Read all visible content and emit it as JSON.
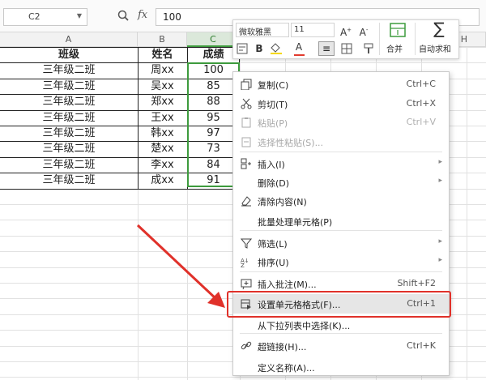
{
  "formula_bar": {
    "name_box": "C2",
    "fx_label": "fx",
    "value": "100"
  },
  "columns": [
    "A",
    "B",
    "C",
    "H"
  ],
  "table": {
    "headers": [
      "班级",
      "姓名",
      "成绩"
    ],
    "rows": [
      [
        "三年级二班",
        "周xx",
        "100"
      ],
      [
        "三年级二班",
        "吴xx",
        "85"
      ],
      [
        "三年级二班",
        "郑xx",
        "88"
      ],
      [
        "三年级二班",
        "王xx",
        "95"
      ],
      [
        "三年级二班",
        "韩xx",
        "97"
      ],
      [
        "三年级二班",
        "楚xx",
        "73"
      ],
      [
        "三年级二班",
        "李xx",
        "84"
      ],
      [
        "三年级二班",
        "成xx",
        "91"
      ]
    ]
  },
  "mini_toolbar": {
    "font_name": "微软雅黑",
    "font_size": "11",
    "bold": "B",
    "font_color": "A",
    "merge_label": "合并",
    "autosum_label": "自动求和"
  },
  "context_menu": {
    "items": [
      {
        "label": "复制(C)",
        "shortcut": "Ctrl+C",
        "icon": "copy-icon"
      },
      {
        "label": "剪切(T)",
        "shortcut": "Ctrl+X",
        "icon": "scissors-icon"
      },
      {
        "label": "粘贴(P)",
        "shortcut": "Ctrl+V",
        "icon": "paste-icon",
        "disabled": true
      },
      {
        "label": "选择性粘贴(S)...",
        "shortcut": "",
        "icon": "paste-special-icon",
        "disabled": true
      },
      {
        "label": "插入(I)",
        "shortcut": "",
        "icon": "insert-icon",
        "submenu": true
      },
      {
        "label": "删除(D)",
        "shortcut": "",
        "icon": "",
        "submenu": true
      },
      {
        "label": "清除内容(N)",
        "shortcut": "",
        "icon": "eraser-icon"
      },
      {
        "label": "批量处理单元格(P)",
        "shortcut": "",
        "icon": ""
      },
      {
        "label": "筛选(L)",
        "shortcut": "",
        "icon": "filter-icon",
        "submenu": true
      },
      {
        "label": "排序(U)",
        "shortcut": "",
        "icon": "sort-icon",
        "submenu": true
      },
      {
        "label": "插入批注(M)...",
        "shortcut": "Shift+F2",
        "icon": "comment-icon"
      },
      {
        "label": "设置单元格格式(F)...",
        "shortcut": "Ctrl+1",
        "icon": "format-cells-icon",
        "highlighted": true
      },
      {
        "label": "从下拉列表中选择(K)...",
        "shortcut": "",
        "icon": ""
      },
      {
        "label": "超链接(H)...",
        "shortcut": "Ctrl+K",
        "icon": "link-icon"
      },
      {
        "label": "定义名称(A)...",
        "shortcut": "",
        "icon": ""
      }
    ]
  },
  "colors": {
    "selection_green": "#3d9b3d",
    "highlight_red": "#e0312a"
  }
}
